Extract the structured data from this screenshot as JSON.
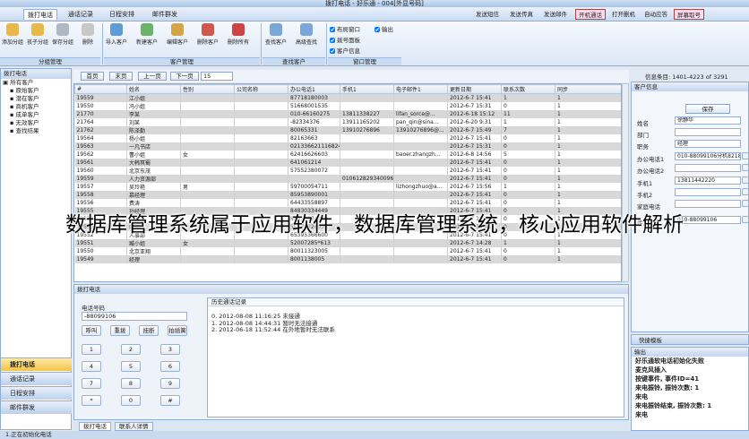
{
  "window": {
    "title": "拨打电话 - 好乐通 - 004[外显号码]"
  },
  "menubar": {
    "tabs": [
      {
        "label": "拨打电话",
        "active": true
      },
      {
        "label": "通话记录",
        "active": false
      },
      {
        "label": "日程安排",
        "active": false
      },
      {
        "label": "邮件群发",
        "active": false
      }
    ],
    "quick_links": [
      "发送短信",
      "发送传真",
      "发送邮件",
      "开机通话",
      "打开删机",
      "自动应答",
      "屏幕取号"
    ]
  },
  "ribbon": {
    "groups": [
      {
        "name": "分组管理",
        "buttons": [
          "添加分组",
          "孩子分组",
          "保存分组",
          "删除"
        ]
      },
      {
        "name": "客户管理",
        "buttons": [
          "导入客户",
          "新建客户",
          "编辑客户",
          "删除客户",
          "删除所有"
        ]
      },
      {
        "name": "查找客户",
        "buttons": [
          "查找客户",
          "高级查找"
        ]
      },
      {
        "name": "窗口管理",
        "checks": [
          "布局窗口",
          "输出",
          "拨号面板",
          "客户信息"
        ]
      }
    ]
  },
  "left_panel": {
    "title": "拨打电话",
    "tree": [
      "所有客户",
      "原始客户",
      "潜在客户",
      "商机客户",
      "成单客户",
      "无效客户",
      "查找结果"
    ],
    "nav": [
      "拨打电话",
      "通话记录",
      "日程安排",
      "邮件群发"
    ]
  },
  "pager": {
    "buttons": [
      "首页",
      "末页",
      "上一页",
      "下一页"
    ],
    "page_size": "15",
    "info": "信息条目: 1401-4223 of 3291"
  },
  "grid": {
    "columns": [
      "#",
      "姓名",
      "性别",
      "公司名称",
      "办公电话1",
      "手机1",
      "电子邮件1",
      "更新日期",
      "联系次数",
      "同步"
    ],
    "rows": [
      [
        "19559",
        "江小姐",
        "",
        "",
        "87718180003",
        "",
        "",
        "2012-6-7 15:41",
        "1",
        "1"
      ],
      [
        "19550",
        "冯小姐",
        "",
        "",
        "51668001535",
        "",
        "",
        "2012-6-7 15:31",
        "0",
        "1"
      ],
      [
        "21770",
        "李某",
        "",
        "",
        "010-66160275",
        "13811338227",
        "lifan_sorce@...",
        "2012-6-18 15:12",
        "11",
        "1"
      ],
      [
        "21764",
        "刘某",
        "",
        "",
        "-82334376",
        "13911165202",
        "pan_qin@sina...",
        "2012-6-20 9:31",
        "1",
        "1"
      ],
      [
        "21762",
        "陈泽勤",
        "",
        "",
        "80065331",
        "13910276896",
        "13910276896@...",
        "2012-6-7 15:49",
        "7",
        "1"
      ],
      [
        "19564",
        "杨小姐",
        "",
        "",
        "82163663",
        "",
        "",
        "2012-6-7 15:41",
        "0",
        "1"
      ],
      [
        "19563",
        "一凡书店",
        "",
        "",
        "021336621116824",
        "",
        "",
        "2012-6-7 15:31",
        "0",
        "1"
      ],
      [
        "19562",
        "曹小姐",
        "女",
        "",
        "62416626603",
        "",
        "baoer.zhangzh...",
        "2012-6-8 14:56",
        "5",
        "1"
      ],
      [
        "19561",
        "大韩冥蜀",
        "",
        "",
        "641061214",
        "",
        "",
        "2012-6-7 15:41",
        "0",
        "1"
      ],
      [
        "19560",
        "北京东茂",
        "",
        "",
        "57552380072",
        "",
        "",
        "2012-6-7 15:41",
        "0",
        "1"
      ],
      [
        "19559",
        "人力资源部",
        "",
        "",
        "",
        "010612829340096",
        "",
        "2012-6-7 15:41",
        "0",
        "1"
      ],
      [
        "19557",
        "吴玲艳",
        "男",
        "",
        "59700054711",
        "",
        "lizhongzhuo@a...",
        "2012-6-7 15:56",
        "1",
        "1"
      ],
      [
        "19558",
        "慕经理",
        "",
        "",
        "85953890001",
        "",
        "",
        "2012-6-7 15:41",
        "0",
        "1"
      ],
      [
        "19556",
        "费涛",
        "",
        "",
        "64433558897",
        "",
        "",
        "2012-6-7 15:41",
        "0",
        "1"
      ],
      [
        "19555",
        "孙经理",
        "",
        "",
        "84830334449",
        "",
        "",
        "2012-6-7 15:41",
        "0",
        "1"
      ],
      [
        "19554",
        "孙经理",
        "",
        "",
        "84830334449",
        "",
        "",
        "2012-6-7 15:41",
        "0",
        "1"
      ],
      [
        "19553",
        "明日",
        "",
        "",
        "59772226036",
        "",
        "",
        "2012-6-7 15:41",
        "0",
        "1"
      ],
      [
        "19552",
        "人事部",
        "",
        "",
        "65395366600",
        "",
        "",
        "2012-6-7 15:41",
        "0",
        "1"
      ],
      [
        "19551",
        "臧小姐",
        "女",
        "",
        "52007285*613",
        "",
        "",
        "2012-6-7 14:28",
        "1",
        "1"
      ],
      [
        "19550",
        "北京亚翔",
        "",
        "",
        "80011323005",
        "",
        "",
        "2012-6-7 15:41",
        "0",
        "1"
      ],
      [
        "19549",
        "经理",
        "",
        "",
        "8001138005",
        "",
        "",
        "2012-6-7 15:41",
        "0",
        "1"
      ]
    ]
  },
  "customer_info": {
    "title": "客户信息",
    "save_label": "保存",
    "fields": [
      {
        "label": "姓名",
        "value": "徐静华"
      },
      {
        "label": "部门",
        "value": ""
      },
      {
        "label": "职务",
        "value": "经理"
      },
      {
        "label": "办公电话1",
        "value": "010-88099106分机8218"
      },
      {
        "label": "办公电话2",
        "value": ""
      },
      {
        "label": "手机1",
        "value": "13811442220"
      },
      {
        "label": "手机2",
        "value": ""
      },
      {
        "label": "家庭电话",
        "value": ""
      },
      {
        "label": "传真",
        "value": "010-88099106"
      }
    ]
  },
  "dial_panel": {
    "title": "拨打电话",
    "phone_label": "电话号码",
    "phone_value": "-88099106",
    "actions": [
      "呼叫",
      "重拨",
      "挂断",
      "拍插簧"
    ],
    "keys": [
      "1",
      "2",
      "3",
      "4",
      "5",
      "6",
      "7",
      "8",
      "9",
      "*",
      "0",
      "#"
    ],
    "history_title": "历史通话记录",
    "history": [
      "0. 2012-08-08 11:16:25  未接通",
      "1. 2012-08-08 14:44:31  暂时无法接通",
      "2. 2012-06-18 11:52:44  在外地暂时无法联系"
    ]
  },
  "bottom_tabs": [
    "拨打电话",
    "联系人详情"
  ],
  "quick_panel": {
    "title": "快捷模板"
  },
  "output": {
    "title": "输出",
    "lines": [
      "好乐通软电话初始化失败",
      "麦克风插入",
      "按键事件, 事件ID=41",
      "来电振铃, 振铃次数: 1",
      "来电",
      "来电振铃结束, 振铃次数: 1",
      "来电"
    ]
  },
  "status": {
    "text": "1.正在初始化电话"
  },
  "overlay": {
    "text": "数据库管理系统属于应用软件，数据库管理系统，核心应用软件解析"
  }
}
